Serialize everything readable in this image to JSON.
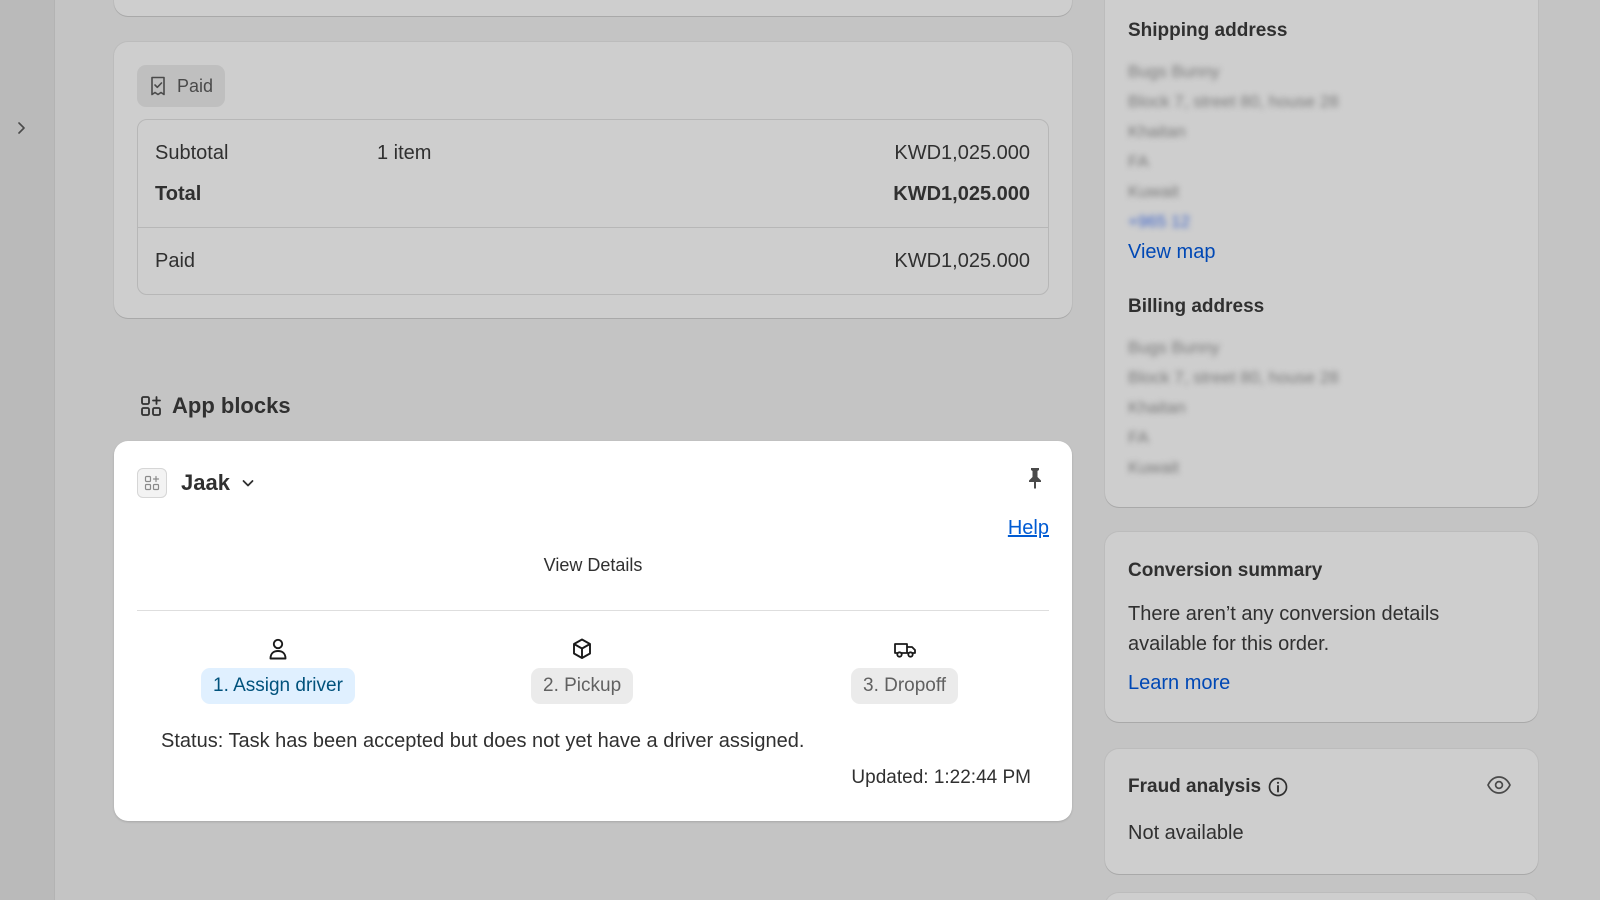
{
  "payment": {
    "badge": "Paid",
    "subtotal_label": "Subtotal",
    "subtotal_items": "1 item",
    "subtotal_amount": "KWD1,025.000",
    "total_label": "Total",
    "total_amount": "KWD1,025.000",
    "paid_label": "Paid",
    "paid_amount": "KWD1,025.000"
  },
  "app_blocks": {
    "title": "App blocks",
    "app_name": "Jaak",
    "help": "Help",
    "view_details": "View Details",
    "steps": [
      {
        "label": "1. Assign driver",
        "icon": "person-icon",
        "active": true
      },
      {
        "label": "2. Pickup",
        "icon": "package-icon",
        "active": false
      },
      {
        "label": "3. Dropoff",
        "icon": "truck-icon",
        "active": false
      }
    ],
    "status": "Status: Task has been accepted but does not yet have a driver assigned.",
    "updated": "Updated: 1:22:44 PM"
  },
  "shipping": {
    "title": "Shipping address",
    "lines": [
      "Bugs Bunny",
      "Block 7, street 80, house 28",
      "Khaitan",
      "FA",
      "Kuwait"
    ],
    "phone": "+965 12",
    "view_map": "View map"
  },
  "billing": {
    "title": "Billing address",
    "lines": [
      "Bugs Bunny",
      "Block 7, street 80, house 28",
      "Khaitan",
      "FA",
      "Kuwait"
    ]
  },
  "conversion": {
    "title": "Conversion summary",
    "text": "There aren’t any conversion details available for this order.",
    "link": "Learn more"
  },
  "fraud": {
    "title": "Fraud analysis",
    "status": "Not available"
  },
  "colors": {
    "link": "#005bd3",
    "active_step_bg": "#e0f0ff",
    "active_step_text": "#00527c"
  }
}
